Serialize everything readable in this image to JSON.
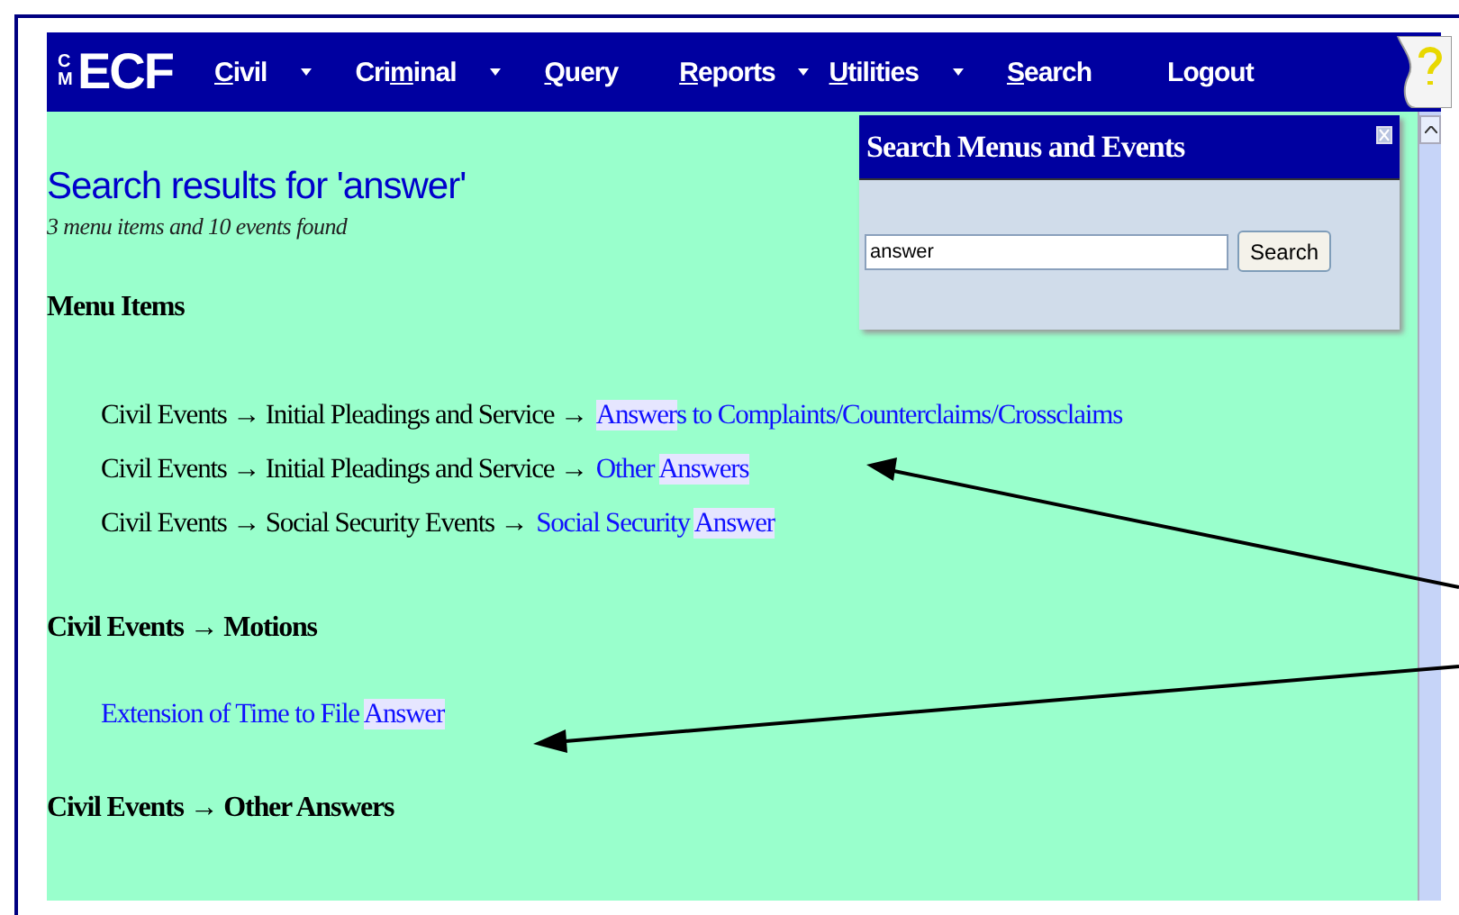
{
  "nav": {
    "logo_prefix": "CM",
    "logo": "ECF",
    "items": [
      {
        "key": "C",
        "post": "ivil",
        "dropdown": true
      },
      {
        "pre": "Cri",
        "key": "m",
        "post": "inal",
        "dropdown": true
      },
      {
        "key": "Q",
        "post": "uery",
        "dropdown": false
      },
      {
        "key": "R",
        "post": "eports",
        "dropdown": true
      },
      {
        "key": "U",
        "post": "tilities",
        "dropdown": true
      },
      {
        "key": "S",
        "post": "earch",
        "dropdown": false
      },
      {
        "pre": "Logout",
        "dropdown": false
      }
    ]
  },
  "search_popup": {
    "title": "Search Menus and Events",
    "value": "answer",
    "button": "Search"
  },
  "heading": "Search results for 'answer'",
  "summary": "3 menu items and 10 events found",
  "menu_items_title": "Menu Items",
  "menu_items": [
    {
      "path": "Civil Events → Initial Pleadings and Service →",
      "link": [
        {
          "text": "Answer",
          "highlight": true
        },
        {
          "text": "s to Complaints/Counterclaims/Crossclaims",
          "highlight": false
        }
      ]
    },
    {
      "path": "Civil Events → Initial Pleadings and Service →",
      "link": [
        {
          "text": "Other ",
          "highlight": false
        },
        {
          "text": "Answers",
          "highlight": true
        }
      ]
    },
    {
      "path": "Civil Events → Social Security Events →",
      "link": [
        {
          "text": "Social Security ",
          "highlight": false
        },
        {
          "text": "Answer",
          "highlight": true
        }
      ]
    }
  ],
  "sections": [
    {
      "title": "Civil Events → Motions",
      "events": [
        {
          "link": [
            {
              "text": "Extension of Time to File ",
              "highlight": false
            },
            {
              "text": "Answer",
              "highlight": true
            }
          ]
        }
      ]
    },
    {
      "title": "Civil Events → Other Answers"
    }
  ]
}
